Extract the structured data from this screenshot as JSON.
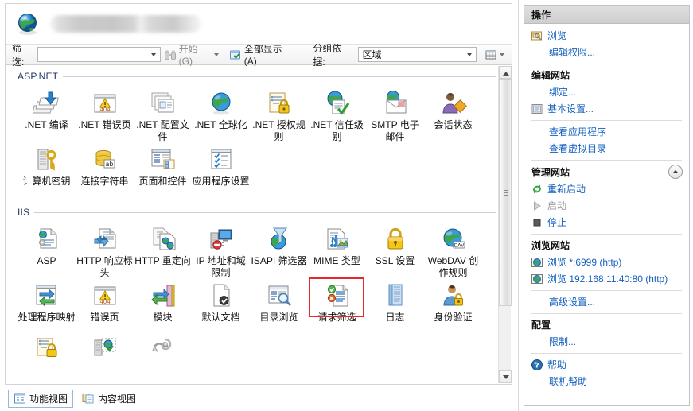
{
  "window": {
    "site_title_redacted": "",
    "globe_icon": "globe-icon"
  },
  "toolbar": {
    "filter_label": "筛选:",
    "filter_value": "",
    "filter_placeholder": "",
    "start_label": "开始(G)",
    "show_all_label": "全部显示(A)",
    "group_by_label": "分组依据:",
    "group_by_value": "区域",
    "view_icon": "grid-view-icon",
    "binoculars_icon": "binoculars-icon",
    "showall_icon": "show-all-icon"
  },
  "groups": [
    {
      "name": "ASP.NET",
      "items": [
        {
          "label": ".NET 编译",
          "icon": "net-compilation-icon"
        },
        {
          "label": ".NET 错误页",
          "icon": "net-error-pages-404-icon"
        },
        {
          "label": ".NET 配置文件",
          "icon": "net-profile-icon"
        },
        {
          "label": ".NET 全球化",
          "icon": "net-globalization-globe-icon"
        },
        {
          "label": ".NET 授权规则",
          "icon": "net-authorization-lock-icon"
        },
        {
          "label": ".NET 信任级别",
          "icon": "net-trust-levels-check-icon"
        },
        {
          "label": "SMTP 电子邮件",
          "icon": "smtp-email-icon"
        },
        {
          "label": "会话状态",
          "icon": "session-state-person-icon"
        },
        {
          "label": "计算机密钥",
          "icon": "machine-key-icon"
        },
        {
          "label": "连接字符串",
          "icon": "connection-strings-db-icon"
        },
        {
          "label": "页面和控件",
          "icon": "pages-and-controls-icon"
        },
        {
          "label": "应用程序设置",
          "icon": "application-settings-icon"
        }
      ]
    },
    {
      "name": "IIS",
      "items": [
        {
          "label": "ASP",
          "icon": "asp-icon"
        },
        {
          "label": "HTTP 响应标头",
          "icon": "http-response-headers-icon"
        },
        {
          "label": "HTTP 重定向",
          "icon": "http-redirect-icon"
        },
        {
          "label": "IP 地址和域限制",
          "icon": "ip-address-domain-restrictions-icon"
        },
        {
          "label": "ISAPI 筛选器",
          "icon": "isapi-filters-icon"
        },
        {
          "label": "MIME 类型",
          "icon": "mime-types-icon"
        },
        {
          "label": "SSL 设置",
          "icon": "ssl-settings-lock-icon"
        },
        {
          "label": "WebDAV 创作规则",
          "icon": "webdav-authoring-rules-icon"
        },
        {
          "label": "处理程序映射",
          "icon": "handler-mappings-icon"
        },
        {
          "label": "错误页",
          "icon": "error-pages-404-icon"
        },
        {
          "label": "模块",
          "icon": "modules-icon"
        },
        {
          "label": "默认文档",
          "icon": "default-document-icon"
        },
        {
          "label": "目录浏览",
          "icon": "directory-browsing-icon"
        },
        {
          "label": "请求筛选",
          "icon": "request-filtering-icon",
          "selected": true
        },
        {
          "label": "日志",
          "icon": "logging-icon"
        },
        {
          "label": "身份验证",
          "icon": "authentication-icon"
        },
        {
          "label": "",
          "icon": "authorization-rules-icon"
        },
        {
          "label": "",
          "icon": "server-certificates-icon"
        },
        {
          "label": "",
          "icon": "feature-delegation-icon"
        }
      ]
    }
  ],
  "view_tabs": [
    {
      "label": "功能视图",
      "icon": "features-view-icon",
      "active": true
    },
    {
      "label": "内容视图",
      "icon": "content-view-icon",
      "active": false
    }
  ],
  "actions": {
    "title": "操作",
    "entries": [
      {
        "type": "link",
        "label": "浏览",
        "icon": "browse-folder-icon"
      },
      {
        "type": "link",
        "label": "编辑权限...",
        "indent": true
      },
      {
        "type": "divider"
      },
      {
        "type": "header",
        "label": "编辑网站"
      },
      {
        "type": "link",
        "label": "绑定...",
        "indent": true
      },
      {
        "type": "link",
        "label": "基本设置...",
        "icon": "basic-settings-icon"
      },
      {
        "type": "divider"
      },
      {
        "type": "link",
        "label": "查看应用程序",
        "indent": true
      },
      {
        "type": "link",
        "label": "查看虚拟目录",
        "indent": true
      },
      {
        "type": "divider"
      },
      {
        "type": "section",
        "label": "管理网站",
        "collapse_icon": "chevron-up-icon"
      },
      {
        "type": "link",
        "label": "重新启动",
        "icon": "restart-icon"
      },
      {
        "type": "link",
        "label": "启动",
        "icon": "start-play-icon",
        "disabled": true
      },
      {
        "type": "link",
        "label": "停止",
        "icon": "stop-square-icon"
      },
      {
        "type": "divider"
      },
      {
        "type": "header",
        "label": "浏览网站"
      },
      {
        "type": "link",
        "label": "浏览 *:6999 (http)",
        "icon": "browse-globe-icon"
      },
      {
        "type": "link",
        "label": "浏览 192.168.11.40:80 (http)",
        "icon": "browse-globe-icon"
      },
      {
        "type": "divider"
      },
      {
        "type": "link",
        "label": "高级设置...",
        "indent": true
      },
      {
        "type": "divider"
      },
      {
        "type": "header",
        "label": "配置"
      },
      {
        "type": "link",
        "label": "限制...",
        "indent": true
      },
      {
        "type": "divider"
      },
      {
        "type": "link",
        "label": "帮助",
        "icon": "help-icon"
      },
      {
        "type": "link",
        "label": "联机帮助",
        "indent": true
      }
    ]
  },
  "colors": {
    "link": "#1560bd",
    "group_header": "#1f3864",
    "selection_highlight": "#e8262b",
    "disabled": "#9a9a9a"
  }
}
